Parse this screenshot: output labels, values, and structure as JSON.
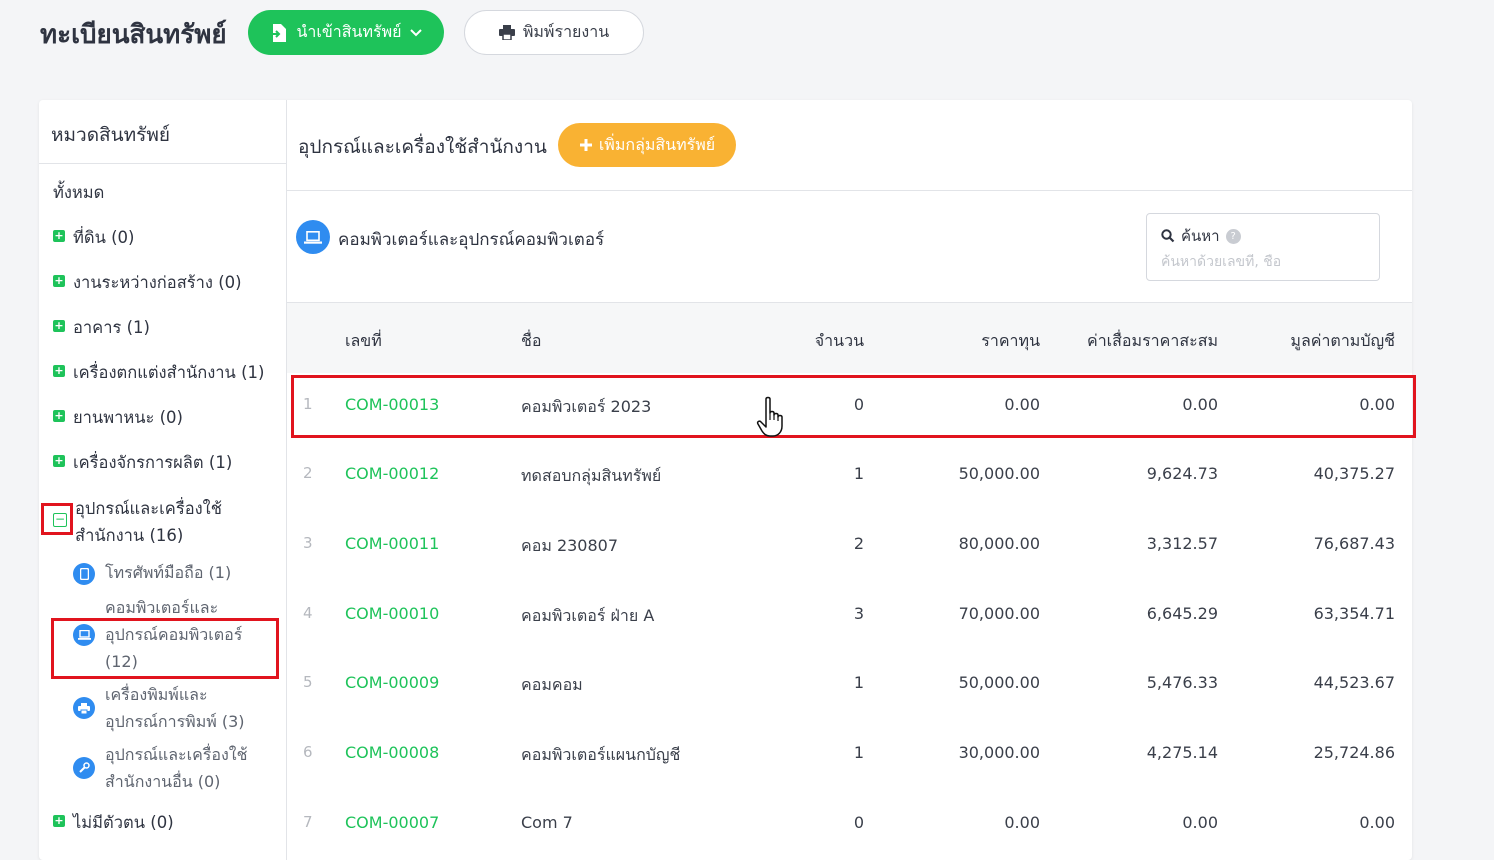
{
  "header": {
    "title": "ทะเบียนสินทรัพย์",
    "import_label": "นำเข้าสินทรัพย์",
    "print_label": "พิมพ์รายงาน"
  },
  "sidebar": {
    "title": "หมวดสินทรัพย์",
    "all_label": "ทั้งหมด",
    "categories": [
      {
        "label": "ที่ดิน (0)"
      },
      {
        "label": "งานระหว่างก่อสร้าง (0)"
      },
      {
        "label": "อาคาร (1)"
      },
      {
        "label": "เครื่องตกแต่งสำนักงาน (1)"
      },
      {
        "label": "ยานพาหนะ (0)"
      },
      {
        "label": "เครื่องจักรการผลิต (1)"
      },
      {
        "label_line1": "อุปกรณ์และเครื่องใช้",
        "label_line2": "สำนักงาน (16)"
      },
      {
        "label": "ไม่มีตัวตน (0)"
      }
    ],
    "subcategories": [
      {
        "label": "โทรศัพท์มือถือ (1)",
        "icon": "mobile-phone-icon"
      },
      {
        "label_line1": "คอมพิวเตอร์และ",
        "label_line2": "อุปกรณ์คอมพิวเตอร์",
        "label_line3": "(12)",
        "icon": "laptop-icon"
      },
      {
        "label_line1": "เครื่องพิมพ์และ",
        "label_line2": "อุปกรณ์การพิมพ์ (3)",
        "icon": "printer-icon"
      },
      {
        "label_line1": "อุปกรณ์และเครื่องใช้",
        "label_line2": "สำนักงานอื่น (0)",
        "icon": "wrench-icon"
      }
    ]
  },
  "main": {
    "group_title": "อุปกรณ์และเครื่องใช้สำนักงาน",
    "add_group_label": "เพิ่มกลุ่มสินทรัพย์",
    "subgroup_title": "คอมพิวเตอร์และอุปกรณ์คอมพิวเตอร์",
    "search": {
      "label": "ค้นหา",
      "placeholder": "ค้นหาด้วยเลขที่, ชื่อ"
    },
    "table": {
      "headers": {
        "code": "เลขที่",
        "name": "ชื่อ",
        "qty": "จำนวน",
        "cost": "ราคาทุน",
        "depreciation": "ค่าเสื่อมราคาสะสม",
        "book_value": "มูลค่าตามบัญชี"
      },
      "rows": [
        {
          "idx": "1",
          "code": "COM-00013",
          "name": "คอมพิวเตอร์ 2023",
          "qty": "0",
          "cost": "0.00",
          "depreciation": "0.00",
          "book_value": "0.00"
        },
        {
          "idx": "2",
          "code": "COM-00012",
          "name": "ทดสอบกลุ่มสินทรัพย์",
          "qty": "1",
          "cost": "50,000.00",
          "depreciation": "9,624.73",
          "book_value": "40,375.27"
        },
        {
          "idx": "3",
          "code": "COM-00011",
          "name": "คอม 230807",
          "qty": "2",
          "cost": "80,000.00",
          "depreciation": "3,312.57",
          "book_value": "76,687.43"
        },
        {
          "idx": "4",
          "code": "COM-00010",
          "name": "คอมพิวเตอร์ ฝ่าย A",
          "qty": "3",
          "cost": "70,000.00",
          "depreciation": "6,645.29",
          "book_value": "63,354.71"
        },
        {
          "idx": "5",
          "code": "COM-00009",
          "name": "คอมคอม",
          "qty": "1",
          "cost": "50,000.00",
          "depreciation": "5,476.33",
          "book_value": "44,523.67"
        },
        {
          "idx": "6",
          "code": "COM-00008",
          "name": "คอมพิวเตอร์แผนกบัญชี",
          "qty": "1",
          "cost": "30,000.00",
          "depreciation": "4,275.14",
          "book_value": "25,724.86"
        },
        {
          "idx": "7",
          "code": "COM-00007",
          "name": "Com 7",
          "qty": "0",
          "cost": "0.00",
          "depreciation": "0.00",
          "book_value": "0.00"
        }
      ]
    }
  },
  "colors": {
    "accent_green": "#1ec35a",
    "accent_orange": "#f9b233",
    "icon_blue": "#2f8cf0",
    "highlight_red": "#e1141e"
  }
}
